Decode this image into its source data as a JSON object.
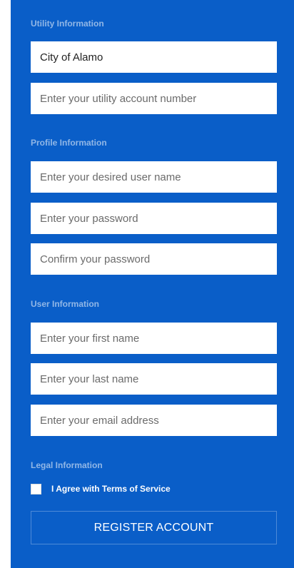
{
  "colors": {
    "panel_background": "#0a5ec8",
    "field_background": "#ffffff",
    "section_label": "#8fb4e6",
    "button_text": "#ffffff"
  },
  "sections": {
    "utility": {
      "label": "Utility Information",
      "utility_name_value": "City of Alamo",
      "account_number_placeholder": "Enter your utility account number"
    },
    "profile": {
      "label": "Profile Information",
      "username_placeholder": "Enter your desired user name",
      "password_placeholder": "Enter your password",
      "confirm_password_placeholder": "Confirm your password"
    },
    "user": {
      "label": "User Information",
      "first_name_placeholder": "Enter your first name",
      "last_name_placeholder": "Enter your last name",
      "email_placeholder": "Enter your email address"
    },
    "legal": {
      "label": "Legal Information",
      "terms_label": "I Agree with Terms of Service",
      "terms_checked": false
    }
  },
  "register_button_label": "REGISTER ACCOUNT"
}
